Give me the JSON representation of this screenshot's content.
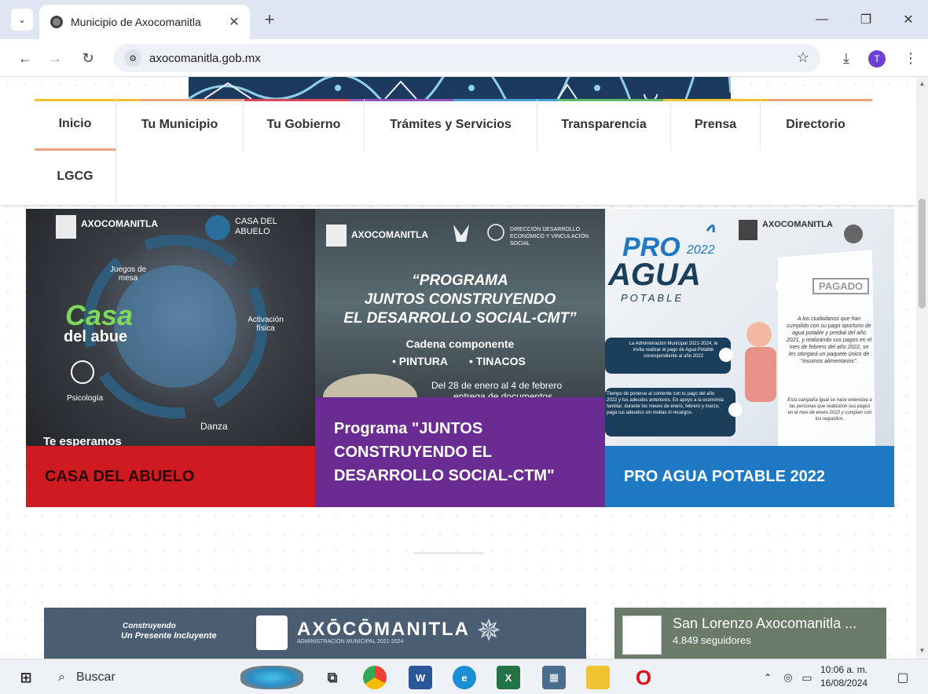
{
  "browser": {
    "tab_title": "Municipio de Axocomanitla",
    "url": "axocomanitla.gob.mx",
    "profile_initial": "T"
  },
  "nav": {
    "items": [
      "Inicio",
      "Tu Municipio",
      "Tu Gobierno",
      "Trámites y Servicios",
      "Transparencia",
      "Prensa",
      "Directorio",
      "LGCG"
    ],
    "strip_colors": [
      "#f2c230",
      "#e9a380",
      "#d9465a",
      "#8e55b6",
      "#4aa0d6",
      "#62b86a",
      "#f2c230",
      "#e9a380"
    ]
  },
  "cards": [
    {
      "caption": "CASA DEL ABUELO",
      "color": "#d01a21",
      "poster": {
        "logo": "AXOCOMANITLA",
        "badge": "CASA DEL ABUELO",
        "title_1": "Casa",
        "title_2": "del abue",
        "features": [
          "Juegos de mesa",
          "Activación física",
          "Psicología",
          "Danza"
        ],
        "footer": "Te esperamos"
      }
    },
    {
      "caption": "Programa \"JUNTOS CONSTRUYENDO EL DESARROLLO SOCIAL-CTM\"",
      "color": "#6a2b92",
      "poster": {
        "logo": "AXOCOMANITLA",
        "department": "DIRECCIÓN DESARROLLO ECONÓMICO Y VINCULACIÓN SOCIAL",
        "headline_1": "“PROGRAMA",
        "headline_2": "JUNTOS CONSTRUYENDO",
        "headline_3": "EL DESARROLLO SOCIAL-CMT”",
        "sub": "Cadena componente",
        "bullets": [
          "• PINTURA",
          "• TINACOS"
        ],
        "dates": "Del 28 de enero al 4 de febrero",
        "dates_2": "entrega de documentos"
      }
    },
    {
      "caption": "PRO AGUA POTABLE 2022",
      "color": "#1f78c4",
      "poster": {
        "logo": "AXOCOMANITLA",
        "title_pro": "PRO",
        "year": "2022",
        "title_agua": "AGUA",
        "title_potable": "POTABLE",
        "stamp": "PAGADO",
        "step_1": "La Administración Municipal 2021-2024, te invita realizar el pago de Agua Potable correspondiente al año 2022",
        "step_2": "Tiempo de ponerse al corriente con tu pago del año 2022 y tus adeudos anteriores. En apoyo a la economía familiar, durante los meses de enero, febrero y marzo, paga tus adeudos sin multas ni recargos.",
        "step_3": "A los ciudadanos que han cumplido con su pago oportuno de agua potable y predial del año 2021, y realizando sus pagos en el mes de febrero del año 2022, se les otorgará un paquete único de \"insumos alimentarios\".",
        "note": "Esta campaña igual se hace extensiva a las personas que realizaron sus pagos en el mes de enero 2022 y cumplan con los requisitos."
      }
    }
  ],
  "bottom_banner": {
    "slogan_1": "Construyendo",
    "slogan_2": "Un Presente Incluyente",
    "logo": "AXŌCŌMANITLA",
    "sub": "ADMINISTRACIÓN MUNICIPAL 2021-2024"
  },
  "facebook": {
    "page_name": "San Lorenzo Axocomanitla ...",
    "followers": "4.849 seguidores"
  },
  "taskbar": {
    "search_placeholder": "Buscar",
    "time": "10:06 a. m.",
    "date": "16/08/2024"
  }
}
